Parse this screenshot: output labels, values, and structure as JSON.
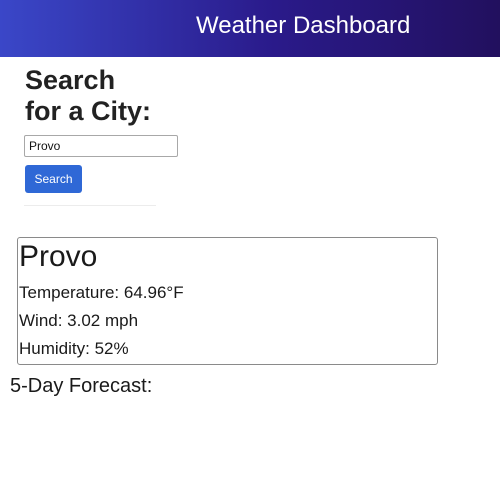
{
  "header": {
    "title": "Weather Dashboard"
  },
  "search": {
    "heading_line1": "Search",
    "heading_line2": "for a City:",
    "input_value": "Provo",
    "button_label": "Search"
  },
  "current": {
    "city": "Provo",
    "temperature": "Temperature: 64.96°F",
    "wind": "Wind: 3.02 mph",
    "humidity": "Humidity: 52%"
  },
  "forecast": {
    "heading": "5-Day Forecast:"
  },
  "colors": {
    "header_gradient_start": "#3a47c8",
    "header_gradient_end": "#22105e",
    "button_bg": "#2f68d6"
  }
}
